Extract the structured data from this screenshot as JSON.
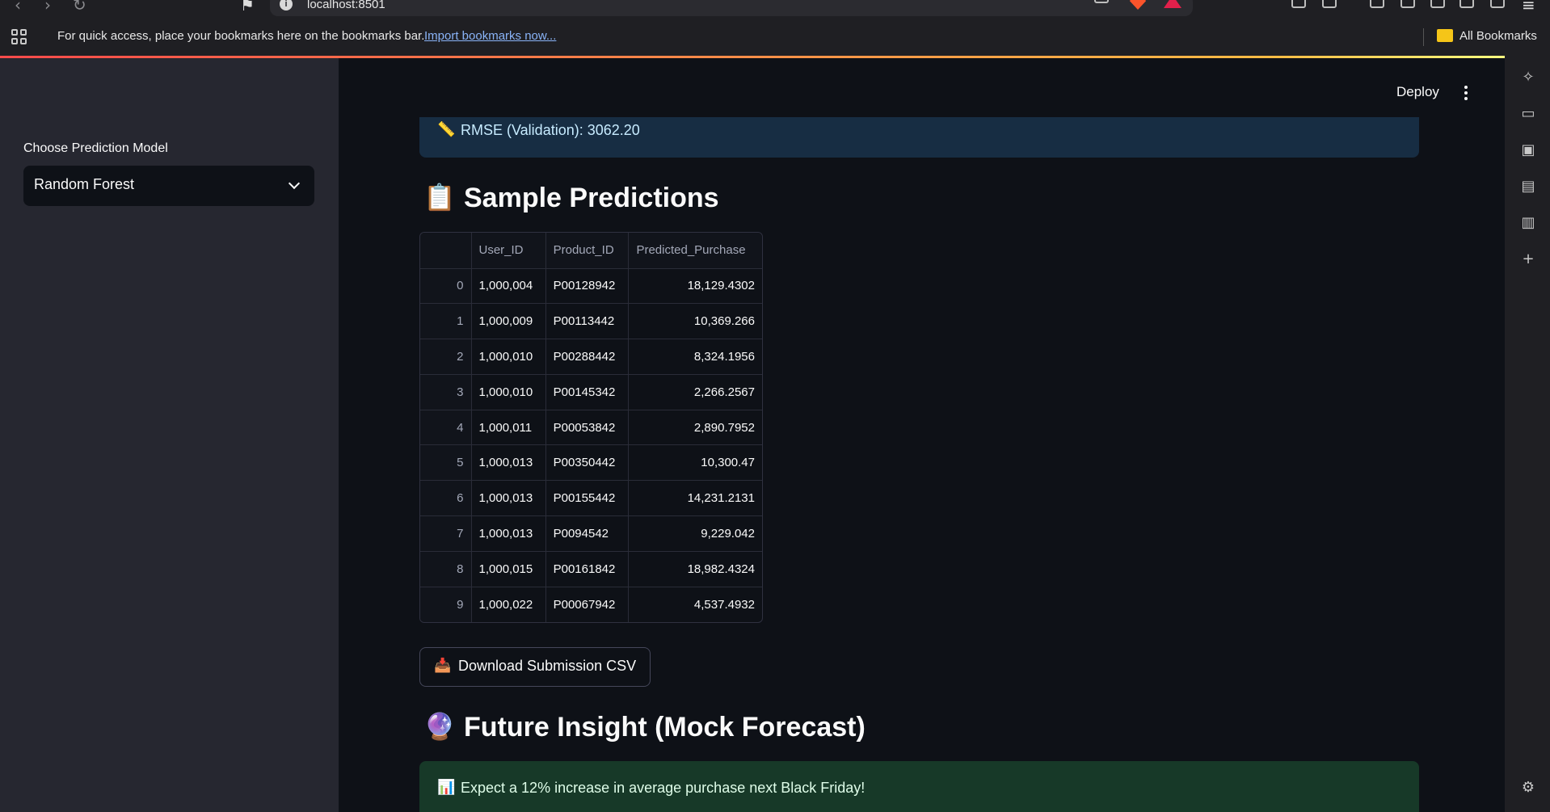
{
  "browser": {
    "url": "localhost:8501",
    "bookmarks_prompt": "For quick access, place your bookmarks here on the bookmarks bar.",
    "import_link": "Import bookmarks now...",
    "all_bookmarks": "All Bookmarks"
  },
  "sidebar": {
    "label": "Choose Prediction Model",
    "selected_model": "Random Forest"
  },
  "header": {
    "deploy_label": "Deploy"
  },
  "metrics": {
    "emoji": "📏",
    "rmse_text": "RMSE (Validation): 3062.20"
  },
  "sample_predictions": {
    "emoji": "📋",
    "title": "Sample Predictions",
    "columns": [
      "",
      "User_ID",
      "Product_ID",
      "Predicted_Purchase"
    ],
    "rows": [
      {
        "idx": "0",
        "user_id": "1,000,004",
        "product_id": "P00128942",
        "predicted": "18,129.4302"
      },
      {
        "idx": "1",
        "user_id": "1,000,009",
        "product_id": "P00113442",
        "predicted": "10,369.266"
      },
      {
        "idx": "2",
        "user_id": "1,000,010",
        "product_id": "P00288442",
        "predicted": "8,324.1956"
      },
      {
        "idx": "3",
        "user_id": "1,000,010",
        "product_id": "P00145342",
        "predicted": "2,266.2567"
      },
      {
        "idx": "4",
        "user_id": "1,000,011",
        "product_id": "P00053842",
        "predicted": "2,890.7952"
      },
      {
        "idx": "5",
        "user_id": "1,000,013",
        "product_id": "P00350442",
        "predicted": "10,300.47"
      },
      {
        "idx": "6",
        "user_id": "1,000,013",
        "product_id": "P00155442",
        "predicted": "14,231.2131"
      },
      {
        "idx": "7",
        "user_id": "1,000,013",
        "product_id": "P0094542",
        "predicted": "9,229.042"
      },
      {
        "idx": "8",
        "user_id": "1,000,015",
        "product_id": "P00161842",
        "predicted": "18,982.4324"
      },
      {
        "idx": "9",
        "user_id": "1,000,022",
        "product_id": "P00067942",
        "predicted": "4,537.4932"
      }
    ]
  },
  "download": {
    "emoji": "📥",
    "label": "Download Submission CSV"
  },
  "future": {
    "emoji": "🔮",
    "title": "Future Insight (Mock Forecast)",
    "insight_emoji": "📊",
    "insight_text": "Expect a 12% increase in average purchase next Black Friday!"
  },
  "colors": {
    "app_bg": "#0e1117",
    "sidebar_bg": "#262730",
    "info_bg": "#172d43",
    "success_bg": "#173928",
    "accent_gradient_start": "#ff4b4b",
    "accent_gradient_end": "#fffd80"
  }
}
